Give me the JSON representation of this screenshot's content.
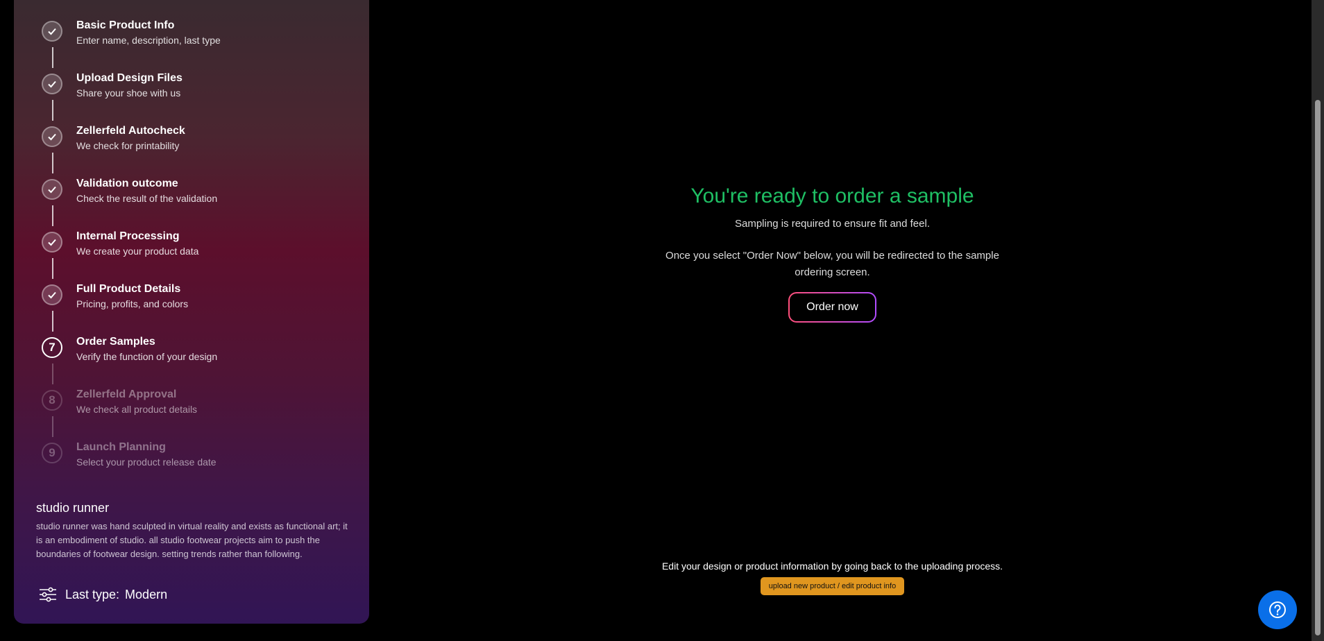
{
  "steps": [
    {
      "number": "1",
      "title": "Basic Product Info",
      "desc": "Enter name, description, last type",
      "state": "done"
    },
    {
      "number": "2",
      "title": "Upload Design Files",
      "desc": "Share your shoe with us",
      "state": "done"
    },
    {
      "number": "3",
      "title": "Zellerfeld Autocheck",
      "desc": "We check for printability",
      "state": "done"
    },
    {
      "number": "4",
      "title": "Validation outcome",
      "desc": "Check the result of the validation",
      "state": "done"
    },
    {
      "number": "5",
      "title": "Internal Processing",
      "desc": "We create your product data",
      "state": "done"
    },
    {
      "number": "6",
      "title": "Full Product Details",
      "desc": "Pricing, profits, and colors",
      "state": "done"
    },
    {
      "number": "7",
      "title": "Order Samples",
      "desc": "Verify the function of your design",
      "state": "current"
    },
    {
      "number": "8",
      "title": "Zellerfeld Approval",
      "desc": "We check all product details",
      "state": "future"
    },
    {
      "number": "9",
      "title": "Launch Planning",
      "desc": "Select your product release date",
      "state": "future"
    }
  ],
  "product": {
    "name": "studio runner",
    "description": "studio runner was hand sculpted in virtual reality and exists as functional art; it is an embodiment of studio. all studio footwear projects aim to push the boundaries of footwear design. setting trends rather than following.",
    "last_type_label": "Last type:",
    "last_type_value": "Modern"
  },
  "main": {
    "heading": "You're ready to order a sample",
    "subheading": "Sampling is required to ensure fit and feel.",
    "info": "Once you select \"Order Now\" below, you will be redirected to the sample ordering screen.",
    "order_button": "Order now",
    "edit_note": "Edit your design or product information by going back to the uploading process.",
    "upload_button": "upload new product / edit product info"
  },
  "icons": {
    "step_done": "check-icon",
    "last_type": "sliders-icon",
    "help": "help-circle-icon"
  },
  "colors": {
    "heading": "#1fbf64",
    "upload_button": "#e0961f",
    "help_button": "#0a6fe8"
  }
}
